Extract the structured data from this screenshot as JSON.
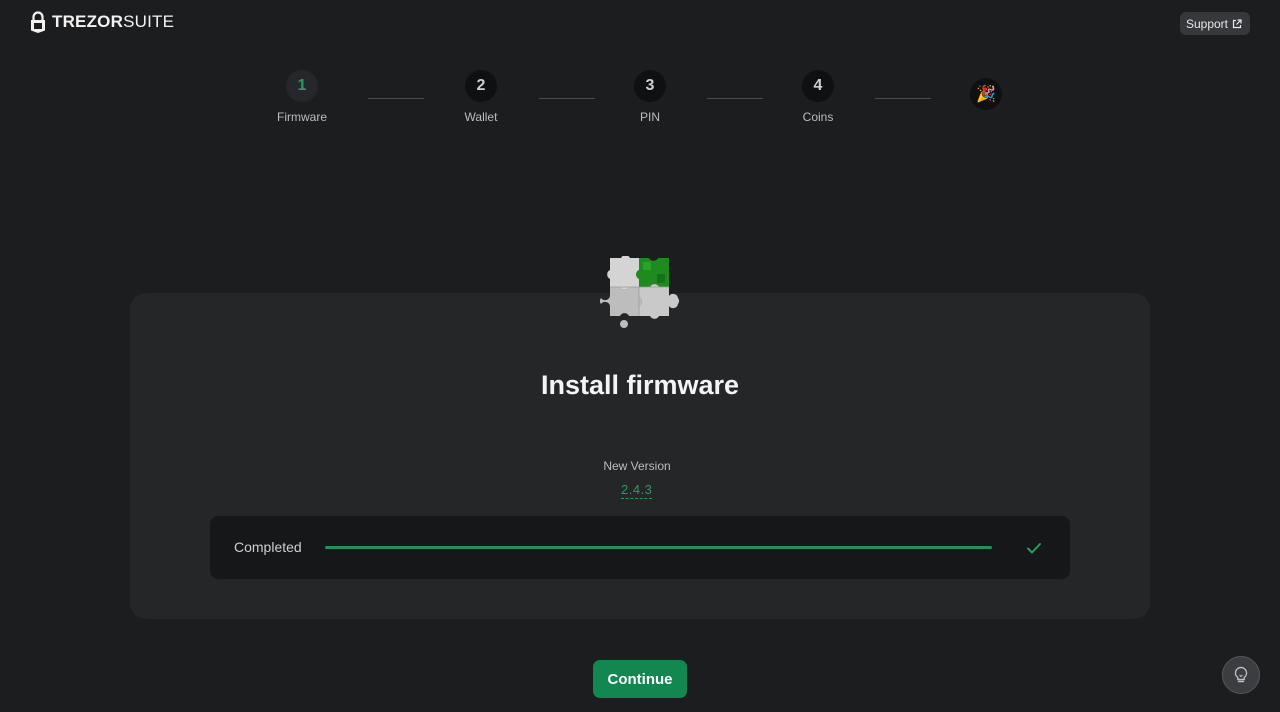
{
  "header": {
    "logo_bold": "TREZOR",
    "logo_light": "SUITE",
    "logo_icon": "lock-icon",
    "support_label": "Support",
    "support_icon": "external-link-icon"
  },
  "stepper": {
    "steps": [
      {
        "number": "1",
        "label": "Firmware",
        "active": true
      },
      {
        "number": "2",
        "label": "Wallet",
        "active": false
      },
      {
        "number": "3",
        "label": "PIN",
        "active": false
      },
      {
        "number": "4",
        "label": "Coins",
        "active": false
      }
    ],
    "final_icon": "party-popper-icon",
    "final_glyph": "🎉"
  },
  "main": {
    "illustration": "puzzle-icon",
    "title": "Install firmware",
    "version_label": "New Version",
    "version_value": "2.4.3",
    "progress": {
      "label": "Completed",
      "fraction": 1.0,
      "status_icon": "checkmark-icon"
    },
    "continue_label": "Continue"
  },
  "footer": {
    "tips_icon": "lightbulb-icon"
  },
  "colors": {
    "background": "#1c1d1f",
    "card": "#252628",
    "accent": "#12874f",
    "accent_text": "#2e9a63"
  }
}
